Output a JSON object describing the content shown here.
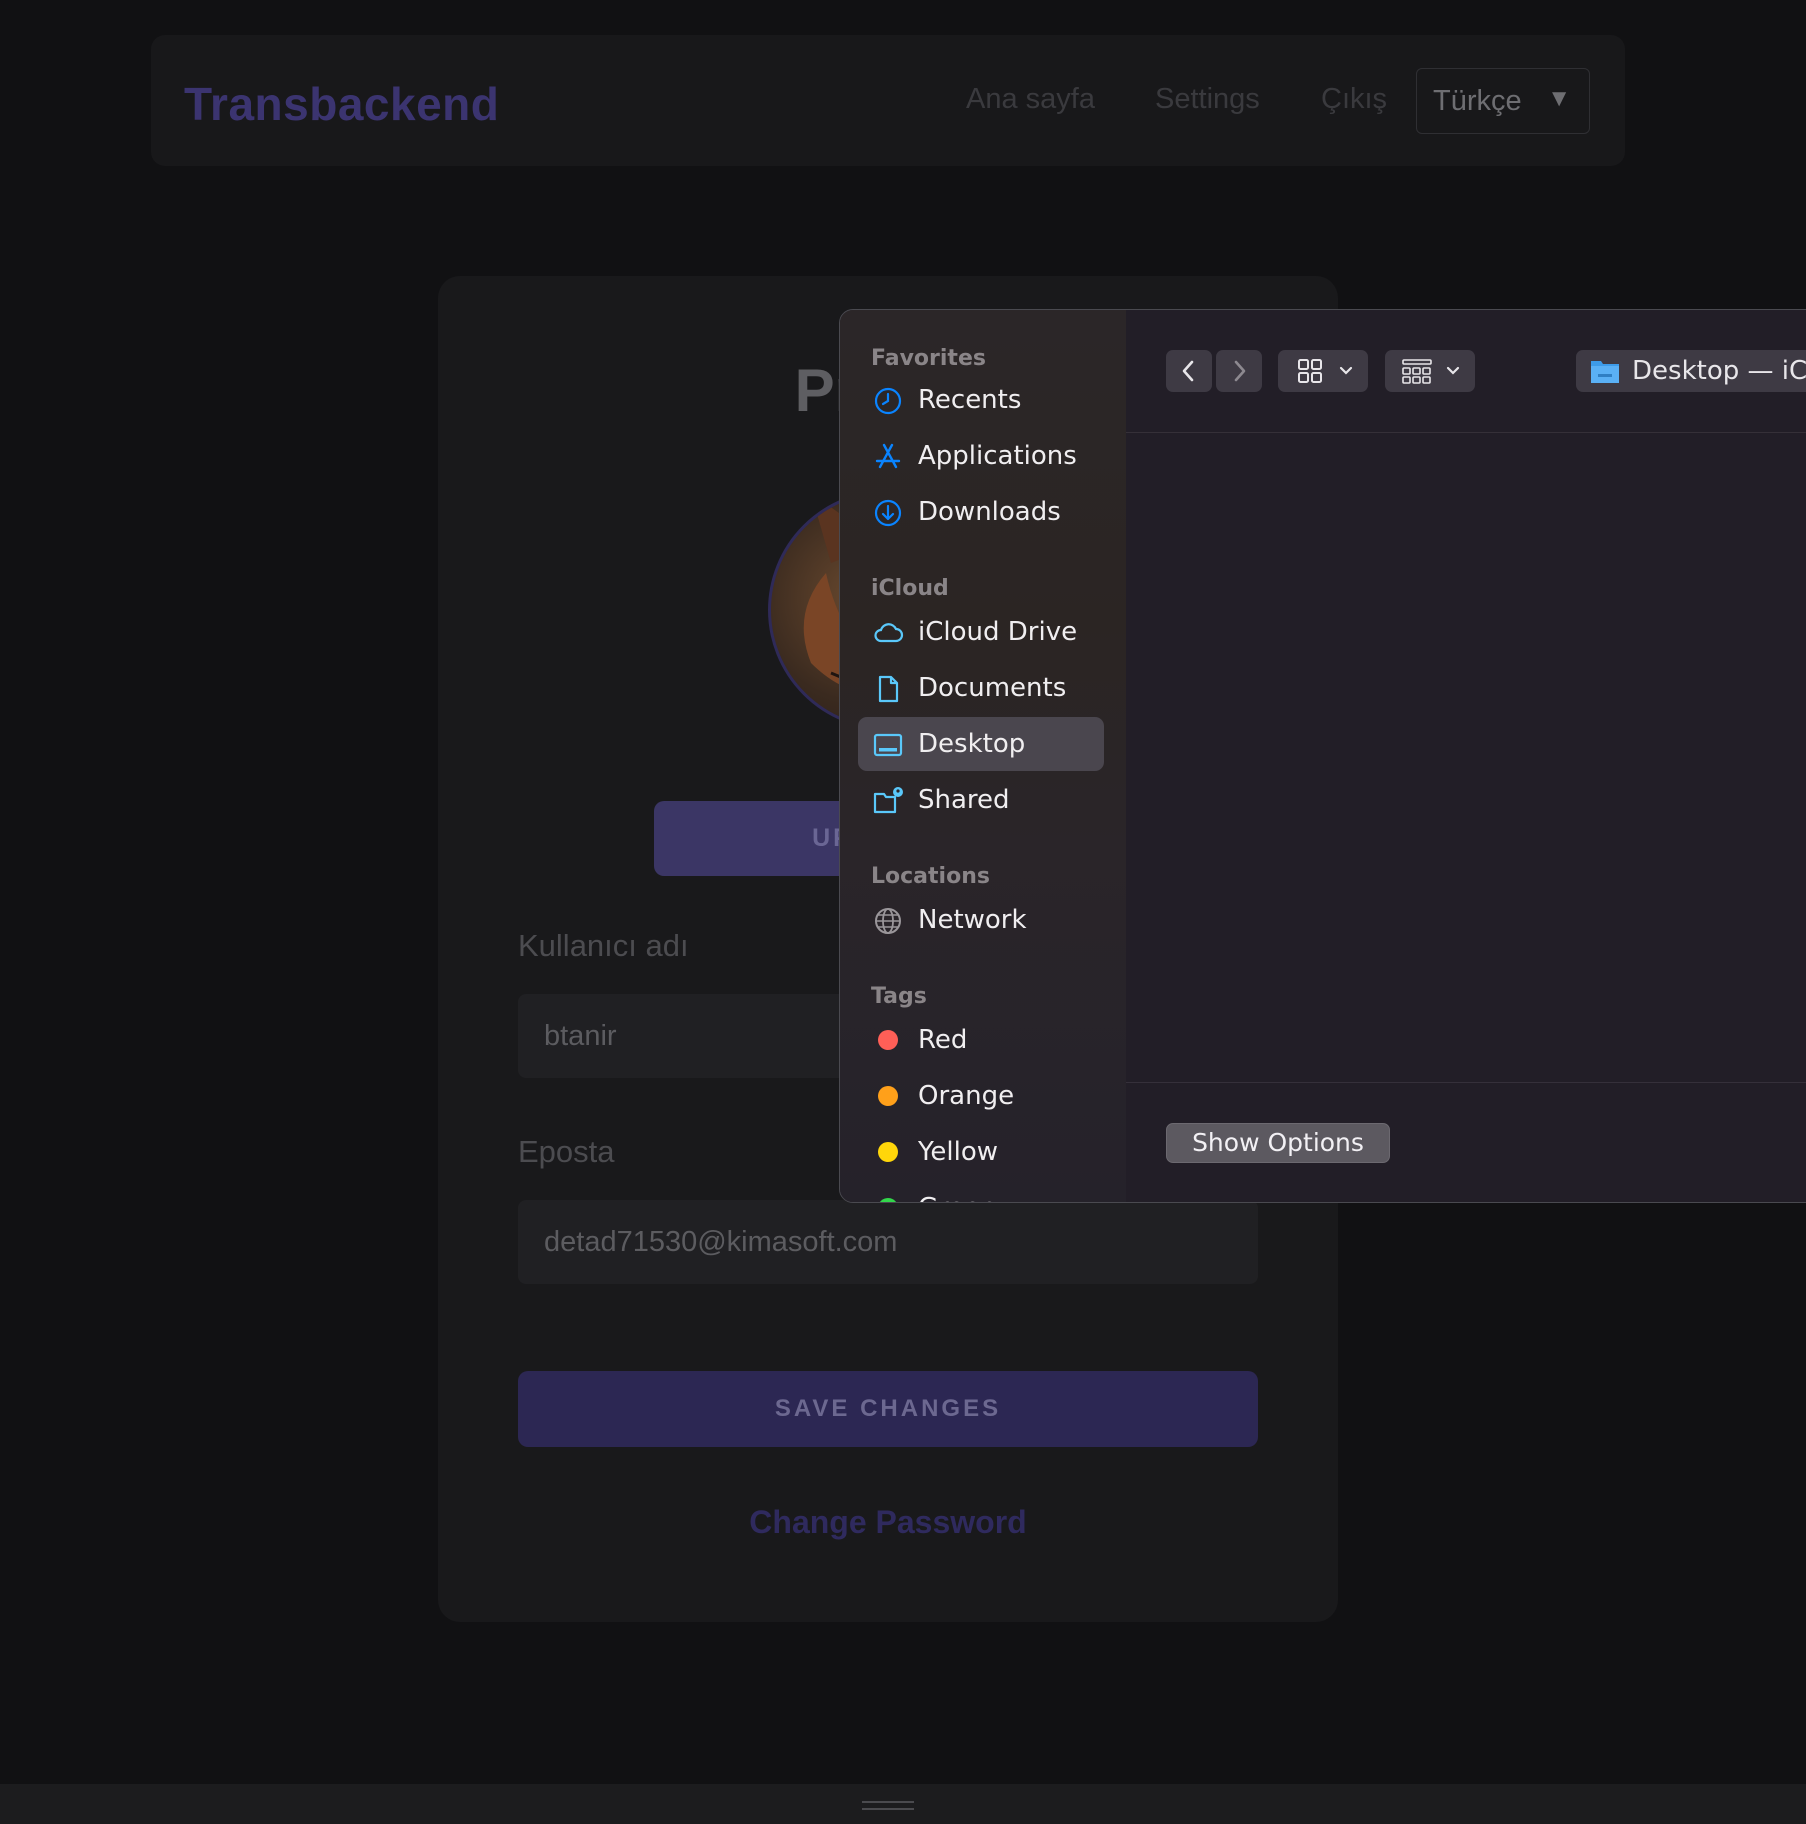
{
  "navbar": {
    "brand": "Transbackend",
    "links": [
      "Ana sayfa",
      "Settings",
      "Çıkış"
    ],
    "language": "Türkçe",
    "language_caret": "▼"
  },
  "profile": {
    "title": "Profile",
    "upload_label": "UPLOAD F",
    "username_label": "Kullanıcı adı",
    "username_value": "btanir",
    "email_label": "Eposta",
    "email_value": "detad71530@kimasoft.com",
    "save_label": "SAVE CHANGES",
    "change_password_label": "Change Password"
  },
  "file_picker": {
    "sections": {
      "favorites": "Favorites",
      "icloud": "iCloud",
      "locations": "Locations",
      "tags": "Tags"
    },
    "favorites": [
      {
        "label": "Recents",
        "icon": "clock-icon"
      },
      {
        "label": "Applications",
        "icon": "applications-icon"
      },
      {
        "label": "Downloads",
        "icon": "download-icon"
      }
    ],
    "icloud": [
      {
        "label": "iCloud Drive",
        "icon": "cloud-icon"
      },
      {
        "label": "Documents",
        "icon": "document-icon"
      },
      {
        "label": "Desktop",
        "icon": "desktop-icon",
        "selected": true
      },
      {
        "label": "Shared",
        "icon": "shared-folder-icon"
      }
    ],
    "locations": [
      {
        "label": "Network",
        "icon": "globe-icon"
      }
    ],
    "tags": [
      {
        "label": "Red",
        "color": "#ff5f57"
      },
      {
        "label": "Orange",
        "color": "#ffa01a"
      },
      {
        "label": "Yellow",
        "color": "#ffd60a"
      },
      {
        "label": "Green",
        "color": "#32d74b"
      }
    ],
    "path_label": "Desktop — iCloud",
    "show_options_label": "Show Options"
  },
  "colors": {
    "accent_icon": "#0a84ff",
    "teal_icon": "#5ac8fa",
    "selected_item": "#4a464e",
    "brand_dim": "#3b3470"
  }
}
